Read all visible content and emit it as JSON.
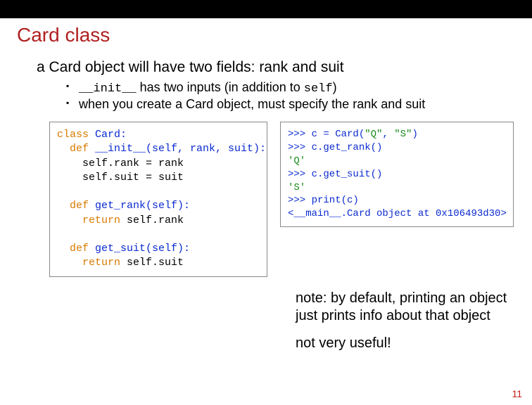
{
  "title": "Card class",
  "sub": "a Card object will have two fields: rank and suit",
  "bullet1_code": "__init__",
  "bullet1_mid": " has two inputs (in addition to ",
  "bullet1_code2": "self",
  "bullet1_tail": ")",
  "bullet2": "when you create a Card object, must specify the rank and suit",
  "codeL_l1a": "class ",
  "codeL_l1b": "Card:",
  "codeL_l2a": "  def ",
  "codeL_l2b": "__init__(self, rank, suit):",
  "codeL_l3": "    self.rank = rank",
  "codeL_l4": "    self.suit = suit",
  "codeL_l5a": "  def ",
  "codeL_l5b": "get_rank(self):",
  "codeL_l6a": "    return ",
  "codeL_l6b": "self.rank",
  "codeL_l7a": "  def ",
  "codeL_l7b": "get_suit(self):",
  "codeL_l8a": "    return ",
  "codeL_l8b": "self.suit",
  "codeR_l1a": ">>> c = Card(",
  "codeR_l1b": "\"Q\"",
  "codeR_l1c": ", ",
  "codeR_l1d": "\"S\"",
  "codeR_l1e": ")",
  "codeR_l2": ">>> c.get_rank()",
  "codeR_l3": "'Q'",
  "codeR_l4": ">>> c.get_suit()",
  "codeR_l5": "'S'",
  "codeR_l6": ">>> print(c)",
  "codeR_l7": "<__main__.Card object at 0x106493d30>",
  "note1": "note: by default, printing an object just prints info about that object",
  "note2": "not very useful!",
  "pagenum": "11"
}
